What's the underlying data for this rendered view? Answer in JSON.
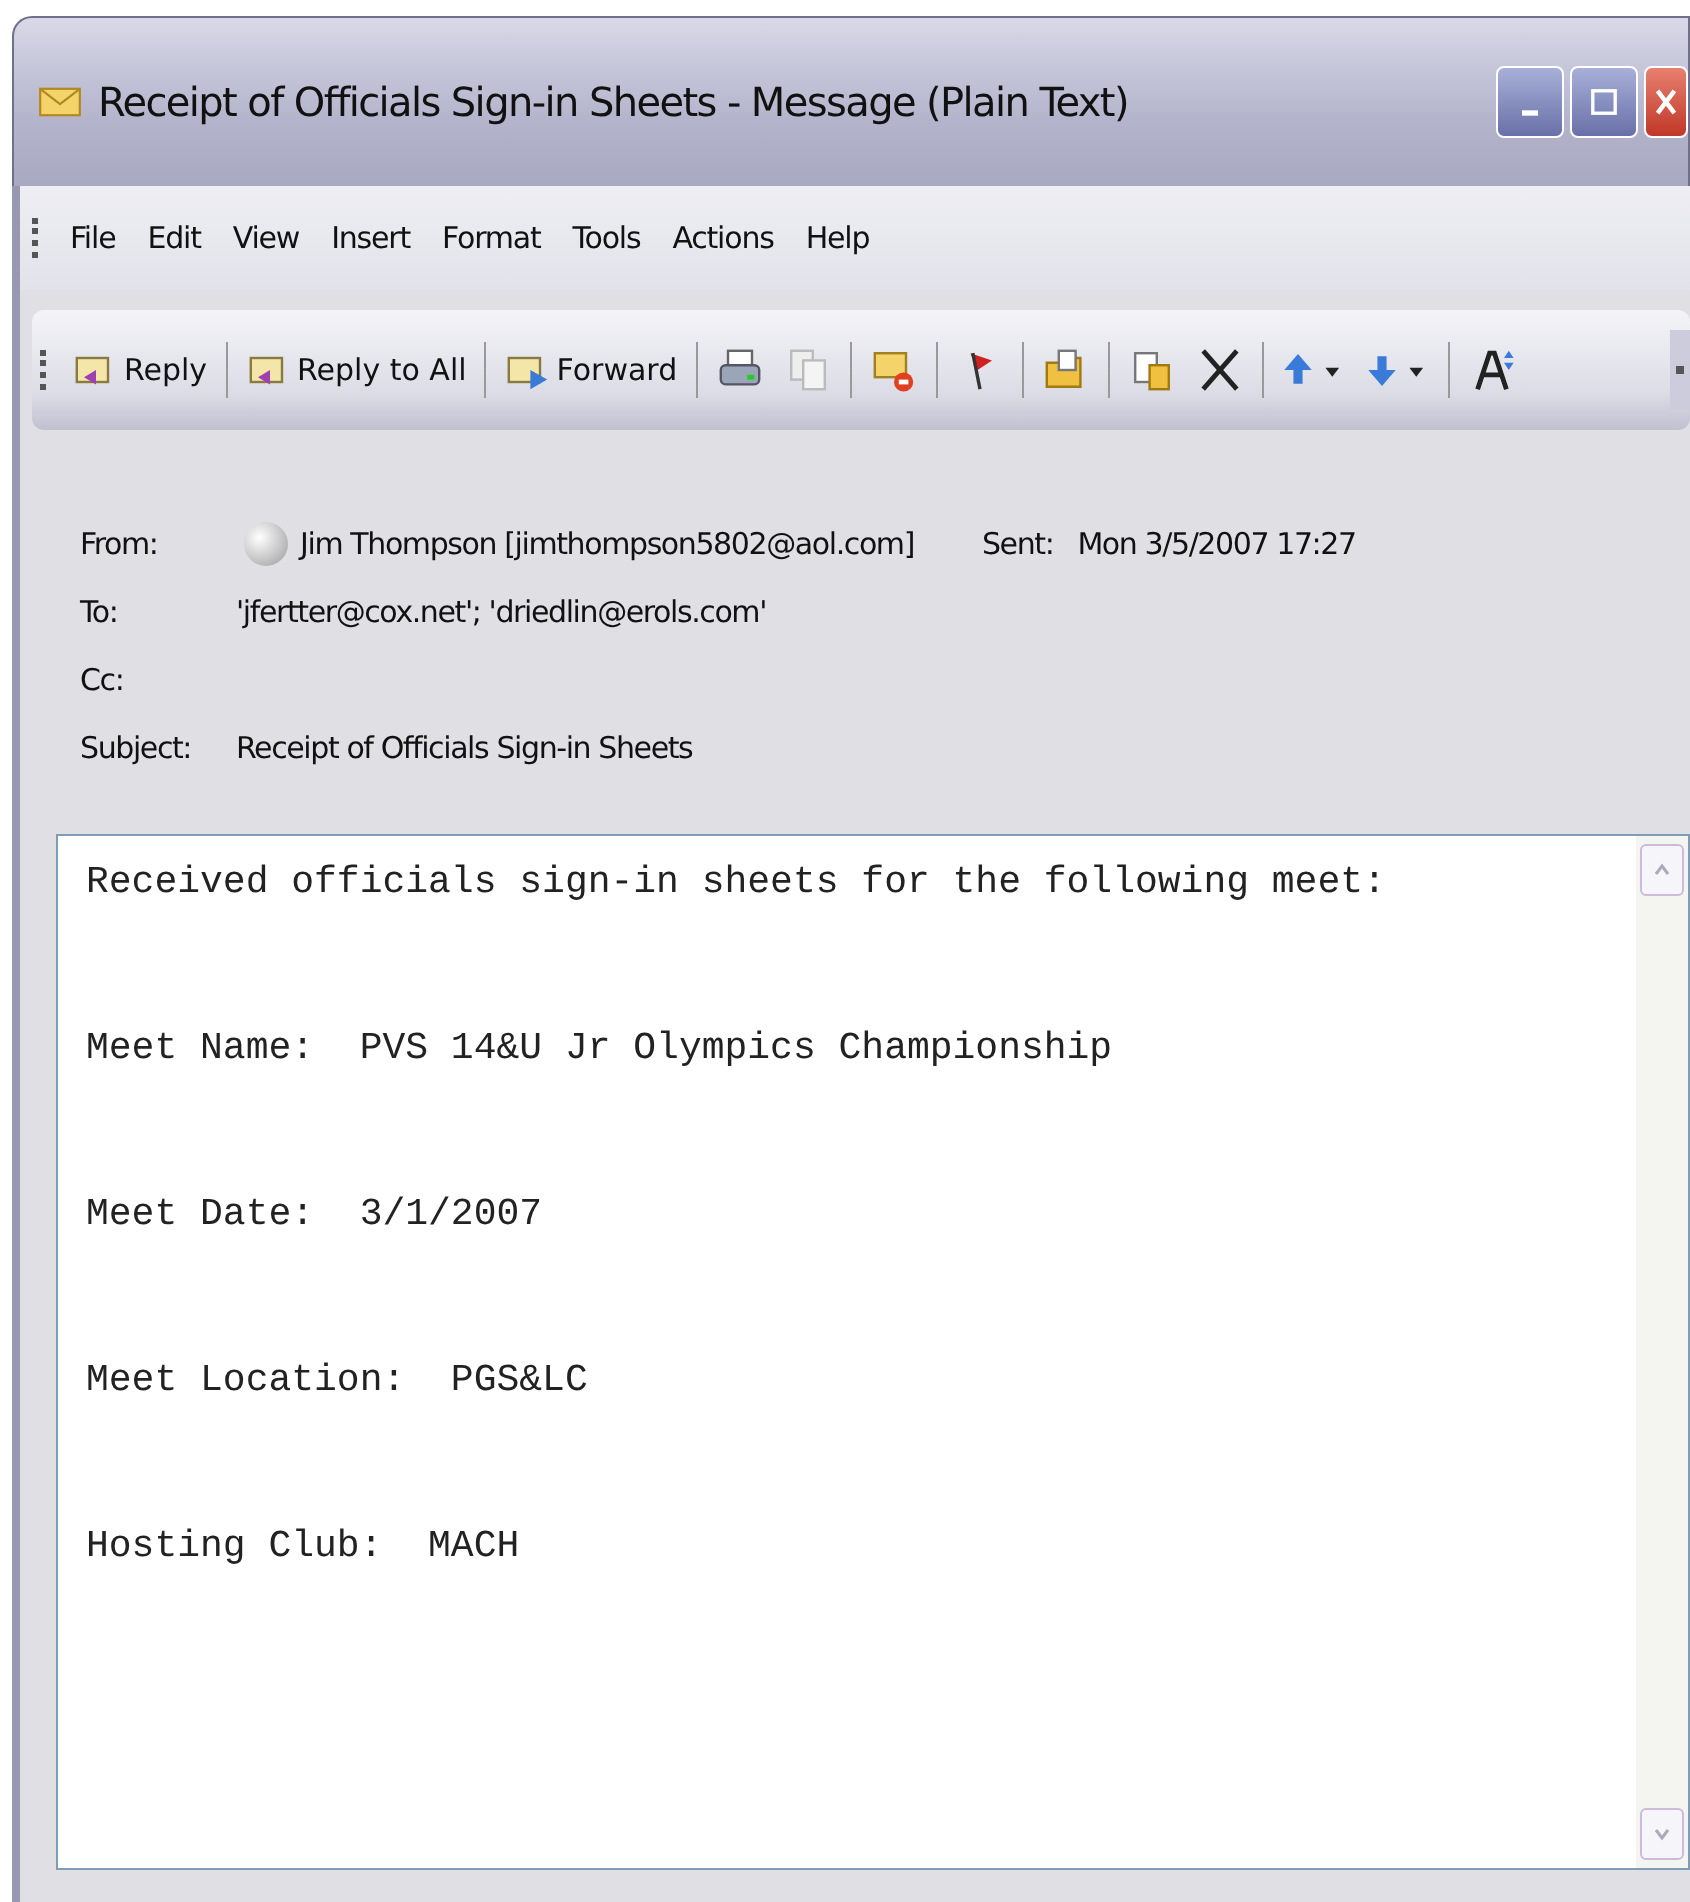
{
  "window": {
    "title": "Receipt of Officials Sign-in Sheets - Message (Plain Text)"
  },
  "menu": [
    "File",
    "Edit",
    "View",
    "Insert",
    "Format",
    "Tools",
    "Actions",
    "Help"
  ],
  "toolbar": [
    {
      "kind": "labeled",
      "label": "Reply"
    },
    {
      "kind": "labeled",
      "label": "Reply to All"
    },
    {
      "kind": "labeled",
      "label": "Forward"
    },
    {
      "kind": "icon"
    },
    {
      "kind": "icon"
    },
    {
      "kind": "icon"
    },
    {
      "kind": "icon"
    },
    {
      "kind": "icon"
    },
    {
      "kind": "icon"
    },
    {
      "kind": "icon"
    },
    {
      "kind": "dropdown"
    },
    {
      "kind": "dropdown"
    },
    {
      "kind": "icon"
    }
  ],
  "header": {
    "from_label": "From:",
    "from": "Jim Thompson [jimthompson5802@aol.com]",
    "sent_label": "Sent:",
    "sent": "Mon 3/5/2007 17:27",
    "to_label": "To:",
    "to": "'jfertter@cox.net'; 'driedlin@erols.com'",
    "cc_label": "Cc:",
    "subject_label": "Subject:",
    "subject": "Receipt of Officials Sign-in Sheets"
  },
  "body": [
    "Received officials sign-in sheets for the following meet:",
    "Meet Name:  PVS 14&U Jr Olympics Championship",
    "Meet Date:  3/1/2007",
    "Meet Location:  PGS&LC",
    "Hosting Club:  MACH"
  ]
}
